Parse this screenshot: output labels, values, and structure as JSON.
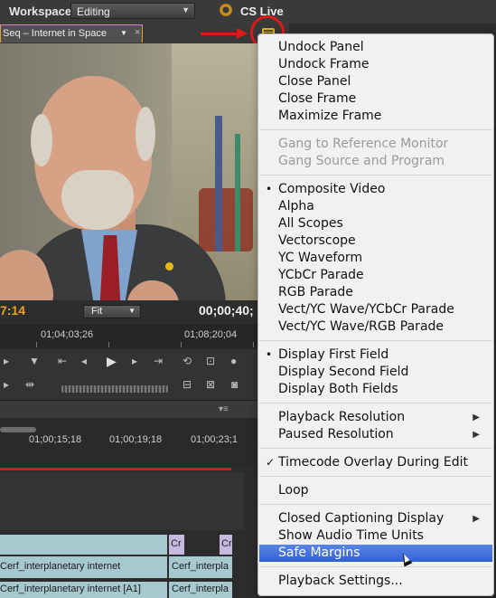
{
  "workspace": {
    "label": "Workspace:",
    "value": "Editing",
    "cs_live": "CS Live"
  },
  "monitor": {
    "tab_label": "Seq – Internet in Space",
    "tab_close": "×",
    "timecode_left": "7:14",
    "zoom": "Fit",
    "timecode_right": "00;00;40;",
    "ruler_left": "01;04;03;26",
    "ruler_right": "01;08;20;04"
  },
  "timeline": {
    "ruler": [
      "01;00;15;18",
      "01;00;19;18",
      "01;00;23;1"
    ],
    "clips": {
      "v1b": "Cr",
      "v1c": "Cr",
      "v2a": "Cerf_interplanetary internet",
      "v2b": "Cerf_interpla",
      "a1a": "Cerf_interplanetary internet [A1]",
      "a1b": "Cerf_interpla"
    }
  },
  "menu": {
    "groups": [
      [
        {
          "label": "Undock Panel"
        },
        {
          "label": "Undock Frame"
        },
        {
          "label": "Close Panel"
        },
        {
          "label": "Close Frame"
        },
        {
          "label": "Maximize Frame"
        }
      ],
      [
        {
          "label": "Gang to Reference Monitor",
          "disabled": true
        },
        {
          "label": "Gang Source and Program",
          "disabled": true
        }
      ],
      [
        {
          "label": "Composite Video",
          "mark": "•"
        },
        {
          "label": "Alpha"
        },
        {
          "label": "All Scopes"
        },
        {
          "label": "Vectorscope"
        },
        {
          "label": "YC Waveform"
        },
        {
          "label": "YCbCr Parade"
        },
        {
          "label": "RGB Parade"
        },
        {
          "label": "Vect/YC Wave/YCbCr Parade"
        },
        {
          "label": "Vect/YC Wave/RGB Parade"
        }
      ],
      [
        {
          "label": "Display First Field",
          "mark": "•"
        },
        {
          "label": "Display Second Field"
        },
        {
          "label": "Display Both Fields"
        }
      ],
      [
        {
          "label": "Playback Resolution",
          "submenu": true
        },
        {
          "label": "Paused Resolution",
          "submenu": true
        }
      ],
      [
        {
          "label": "Timecode Overlay During Edit",
          "mark": "✓"
        }
      ],
      [
        {
          "label": "Loop"
        }
      ],
      [
        {
          "label": "Closed Captioning Display",
          "submenu": true
        },
        {
          "label": "Show Audio Time Units"
        },
        {
          "label": "Safe Margins",
          "selected": true
        }
      ],
      [
        {
          "label": "Playback Settings..."
        }
      ]
    ]
  }
}
